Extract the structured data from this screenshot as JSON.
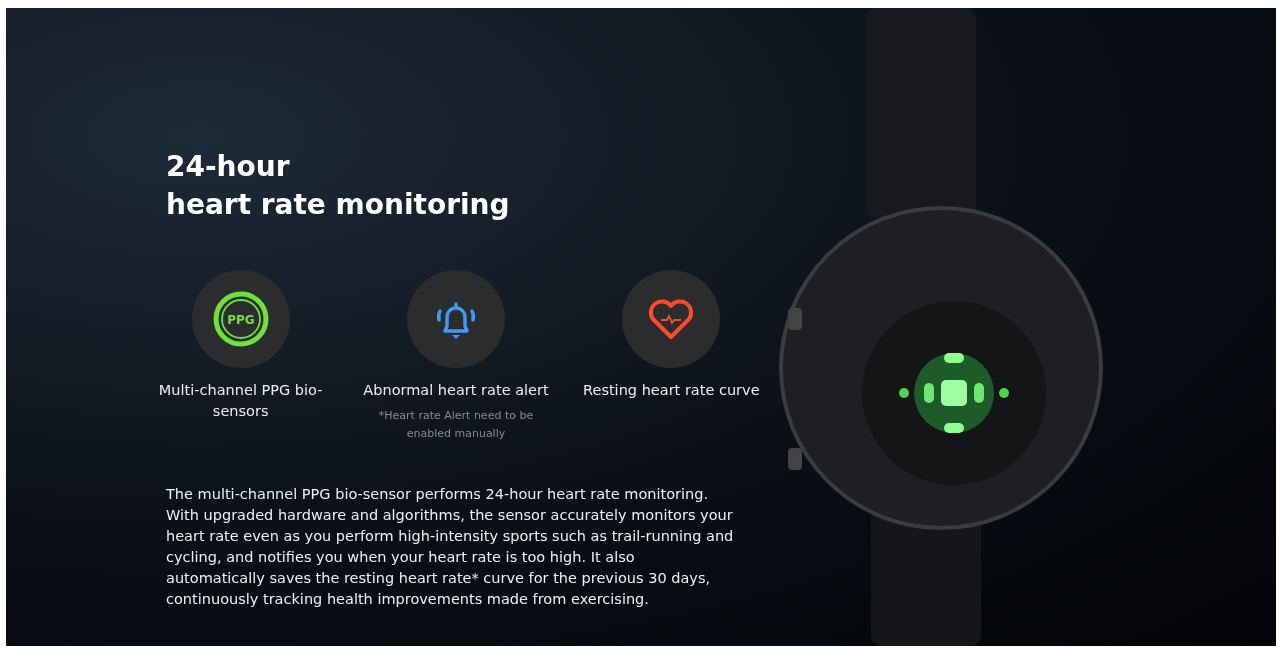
{
  "heading": {
    "lines": [
      "24-hour",
      "heart rate monitoring"
    ]
  },
  "features": [
    {
      "kind": "ppg",
      "icon_text": "PPG",
      "label": "Multi-channel PPG bio-sensors"
    },
    {
      "kind": "bell",
      "label": "Abnormal heart rate alert",
      "note": "*Heart rate Alert need to be enabled manually"
    },
    {
      "kind": "heart",
      "label": "Resting heart rate curve"
    }
  ],
  "description": "The multi-channel PPG bio-sensor performs 24-hour heart rate monitoring. With upgraded hardware and algorithms, the sensor accurately monitors your heart rate even as you perform high-intensity sports such as trail-running and cycling, and notifies you when your heart rate is too high. It also automatically saves the resting heart rate* curve for the previous 30 days, continuously tracking health improvements made from exercising."
}
